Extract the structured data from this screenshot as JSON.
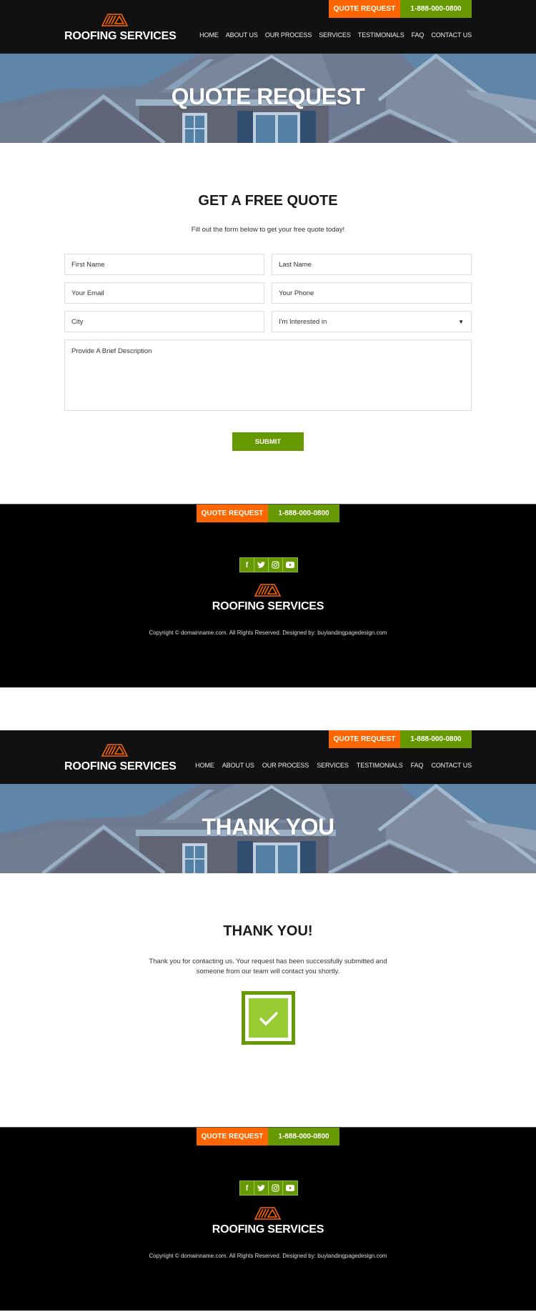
{
  "brand": {
    "name": "ROOFING SERVICES",
    "logo_icon": "roof-stripes-icon",
    "colors": {
      "orange": "#ff6600",
      "green": "#669900",
      "light_green": "#99cc33",
      "header_bg": "#111111",
      "footer_bg": "#000000"
    }
  },
  "header": {
    "cta_quote": "QUOTE REQUEST",
    "cta_phone": "1-888-000-0800",
    "nav": [
      "HOME",
      "ABOUT US",
      "OUR PROCESS",
      "SERVICES",
      "TESTIMONIALS",
      "FAQ",
      "CONTACT US"
    ]
  },
  "quote_page": {
    "hero_title": "QUOTE REQUEST",
    "title": "GET A FREE QUOTE",
    "subtitle": "Fill out the form below to get your free quote today!",
    "form": {
      "first_name_placeholder": "First Name",
      "last_name_placeholder": "Last Name",
      "email_placeholder": "Your Email",
      "phone_placeholder": "Your Phone",
      "city_placeholder": "City",
      "interest_selected": "I'm Interested in",
      "description_placeholder": "Provide A Brief Description",
      "submit_label": "SUBMIT"
    }
  },
  "thank_you_page": {
    "hero_title": "THANK YOU",
    "title": "THANK YOU!",
    "message_line1": "Thank you for contacting us. Your request has been successfully submitted and",
    "message_line2": "someone from our team will contact you shortly.",
    "icon": "checkmark-icon"
  },
  "footer": {
    "cta_quote": "QUOTE REQUEST",
    "cta_phone": "1-888-000-0800",
    "social": [
      {
        "name": "facebook",
        "glyph": "f"
      },
      {
        "name": "twitter",
        "glyph": "t"
      },
      {
        "name": "instagram",
        "glyph": "i"
      },
      {
        "name": "youtube",
        "glyph": "y"
      }
    ],
    "copyright": "Copyright © domainname.com. All Rights Reserved. Designed by: buylandingpagedesign.com"
  }
}
